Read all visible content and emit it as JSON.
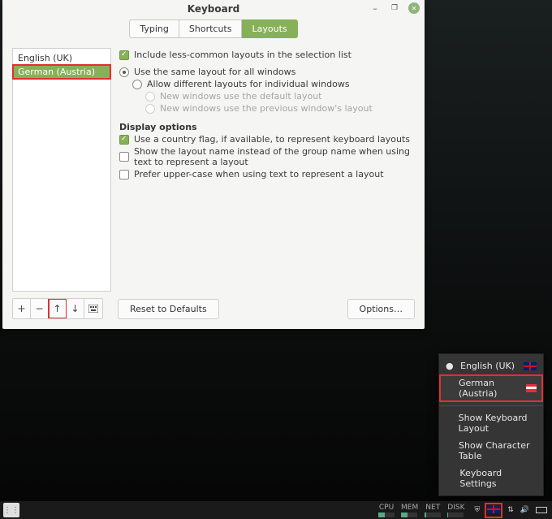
{
  "title": "Keyboard",
  "tabs": {
    "typing": "Typing",
    "shortcuts": "Shortcuts",
    "layouts": "Layouts"
  },
  "layout_list": {
    "items": [
      "English (UK)",
      "German (Austria)"
    ]
  },
  "options": {
    "include_less_common": "Include less-common layouts in the selection list",
    "same_layout_all": "Use the same layout for all windows",
    "allow_diff_per_window": "Allow different layouts for individual windows",
    "new_default": "New windows use the default layout",
    "new_previous": "New windows use the previous window's layout"
  },
  "display_header": "Display options",
  "display": {
    "use_flag": "Use a country flag, if available, to represent keyboard layouts",
    "show_layout_name": "Show the layout name instead of the group name when using text to represent a layout",
    "prefer_upper": "Prefer upper-case when using text to represent a layout"
  },
  "buttons": {
    "reset": "Reset to Defaults",
    "options": "Options…"
  },
  "menu": {
    "english_uk": "English (UK)",
    "german_at": "German (Austria)",
    "show_layout": "Show Keyboard Layout",
    "show_chartable": "Show Character Table",
    "kb_settings": "Keyboard Settings"
  },
  "taskbar": {
    "cpu": "CPU",
    "mem": "MEM",
    "net": "NET",
    "disk": "DISK"
  }
}
